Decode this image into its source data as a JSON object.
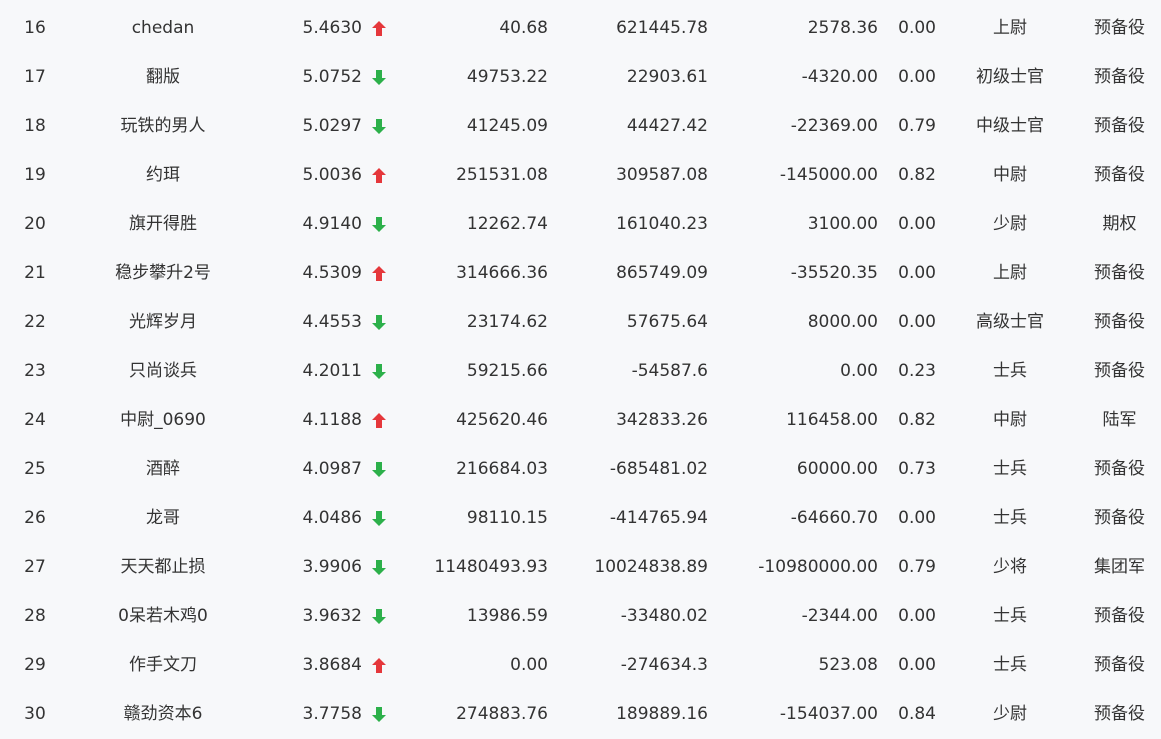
{
  "colors": {
    "up": "#e5373b",
    "down": "#2cb04a",
    "text": "#333333",
    "background": "#f7f8fa"
  },
  "rows": [
    {
      "rank": "16",
      "name": "chedan",
      "score": "5.4630",
      "trend": "up",
      "v1": "40.68",
      "v2": "621445.78",
      "v3": "2578.36",
      "v4": "0.00",
      "title": "上尉",
      "type": "预备役"
    },
    {
      "rank": "17",
      "name": "翻版",
      "score": "5.0752",
      "trend": "down",
      "v1": "49753.22",
      "v2": "22903.61",
      "v3": "-4320.00",
      "v4": "0.00",
      "title": "初级士官",
      "type": "预备役"
    },
    {
      "rank": "18",
      "name": "玩铁的男人",
      "score": "5.0297",
      "trend": "down",
      "v1": "41245.09",
      "v2": "44427.42",
      "v3": "-22369.00",
      "v4": "0.79",
      "title": "中级士官",
      "type": "预备役"
    },
    {
      "rank": "19",
      "name": "约珥",
      "score": "5.0036",
      "trend": "up",
      "v1": "251531.08",
      "v2": "309587.08",
      "v3": "-145000.00",
      "v4": "0.82",
      "title": "中尉",
      "type": "预备役"
    },
    {
      "rank": "20",
      "name": "旗开得胜",
      "score": "4.9140",
      "trend": "down",
      "v1": "12262.74",
      "v2": "161040.23",
      "v3": "3100.00",
      "v4": "0.00",
      "title": "少尉",
      "type": "期权"
    },
    {
      "rank": "21",
      "name": "稳步攀升2号",
      "score": "4.5309",
      "trend": "up",
      "v1": "314666.36",
      "v2": "865749.09",
      "v3": "-35520.35",
      "v4": "0.00",
      "title": "上尉",
      "type": "预备役"
    },
    {
      "rank": "22",
      "name": "光辉岁月",
      "score": "4.4553",
      "trend": "down",
      "v1": "23174.62",
      "v2": "57675.64",
      "v3": "8000.00",
      "v4": "0.00",
      "title": "高级士官",
      "type": "预备役"
    },
    {
      "rank": "23",
      "name": "只尚谈兵",
      "score": "4.2011",
      "trend": "down",
      "v1": "59215.66",
      "v2": "-54587.6",
      "v3": "0.00",
      "v4": "0.23",
      "title": "士兵",
      "type": "预备役"
    },
    {
      "rank": "24",
      "name": "中尉_0690",
      "score": "4.1188",
      "trend": "up",
      "v1": "425620.46",
      "v2": "342833.26",
      "v3": "116458.00",
      "v4": "0.82",
      "title": "中尉",
      "type": "陆军"
    },
    {
      "rank": "25",
      "name": "酒醉",
      "score": "4.0987",
      "trend": "down",
      "v1": "216684.03",
      "v2": "-685481.02",
      "v3": "60000.00",
      "v4": "0.73",
      "title": "士兵",
      "type": "预备役"
    },
    {
      "rank": "26",
      "name": "龙哥",
      "score": "4.0486",
      "trend": "down",
      "v1": "98110.15",
      "v2": "-414765.94",
      "v3": "-64660.70",
      "v4": "0.00",
      "title": "士兵",
      "type": "预备役"
    },
    {
      "rank": "27",
      "name": "天天都止损",
      "score": "3.9906",
      "trend": "down",
      "v1": "11480493.93",
      "v2": "10024838.89",
      "v3": "-10980000.00",
      "v4": "0.79",
      "title": "少将",
      "type": "集团军"
    },
    {
      "rank": "28",
      "name": "0呆若木鸡0",
      "score": "3.9632",
      "trend": "down",
      "v1": "13986.59",
      "v2": "-33480.02",
      "v3": "-2344.00",
      "v4": "0.00",
      "title": "士兵",
      "type": "预备役"
    },
    {
      "rank": "29",
      "name": "作手文刀",
      "score": "3.8684",
      "trend": "up",
      "v1": "0.00",
      "v2": "-274634.3",
      "v3": "523.08",
      "v4": "0.00",
      "title": "士兵",
      "type": "预备役"
    },
    {
      "rank": "30",
      "name": "赣劲资本6",
      "score": "3.7758",
      "trend": "down",
      "v1": "274883.76",
      "v2": "189889.16",
      "v3": "-154037.00",
      "v4": "0.84",
      "title": "少尉",
      "type": "预备役"
    }
  ]
}
